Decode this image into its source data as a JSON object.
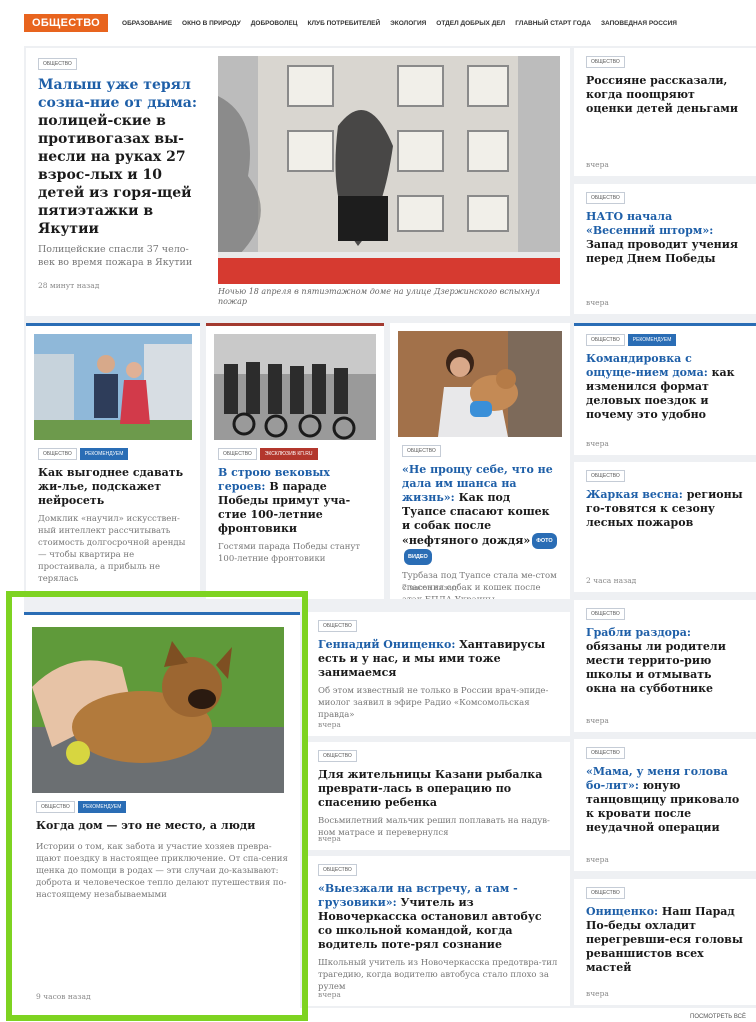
{
  "header": {
    "section": "ОБЩЕСТВО",
    "nav": [
      "ОБРАЗОВАНИЕ",
      "ОКНО В ПРИРОДУ",
      "ДОБРОВОЛЕЦ",
      "КЛУБ ПОТРЕБИТЕЛЕЙ",
      "ЭКОЛОГИЯ",
      "ОТДЕЛ ДОБРЫХ ДЕЛ",
      "ГЛАВНЫЙ СТАРТ ГОДА",
      "ЗАПОВЕДНАЯ РОССИЯ"
    ]
  },
  "main": {
    "tag": "ОБЩЕСТВО",
    "lead": "Малыш уже терял созна-ние от дыма:",
    "title": " полицей-ские в противогазах вы-несли на руках 27 взрос-лых и 10 детей из горя-щей пятиэтажки в Якутии",
    "desc": "Полицейские спасли 37 чело-век во время пожара в Якутии",
    "time": "28 минут назад",
    "caption": "Ночью 18 апреля в пятиэтажном доме на улице Дзержинского вспыхнул пожар"
  },
  "right_cards": [
    {
      "tags": [
        "ОБЩЕСТВО"
      ],
      "lead": "",
      "title": "Россияне рассказали, когда поощряют оценки детей деньгами",
      "time": "вчера"
    },
    {
      "tags": [
        "ОБЩЕСТВО"
      ],
      "lead": "НАТО начала «Весенний шторм»:",
      "title": " Запад проводит учения перед Днем Победы",
      "time": "вчера"
    },
    {
      "tags": [
        "ОБЩЕСТВО",
        "РЕКОМЕНДУЕМ"
      ],
      "lead": "Командировка с ощуще-нием дома:",
      "title": " как изменился формат деловых поездок и почему это удобно",
      "time": "вчера"
    },
    {
      "tags": [
        "ОБЩЕСТВО"
      ],
      "lead": "Жаркая весна:",
      "title": " регионы го-товятся к сезону лесных пожаров",
      "time": "2 часа назад"
    },
    {
      "tags": [
        "ОБЩЕСТВО"
      ],
      "lead": "Грабли раздора:",
      "title": " обязаны ли родители мести террито-рию школы и отмывать окна на субботнике",
      "time": "вчера"
    },
    {
      "tags": [
        "ОБЩЕСТВО"
      ],
      "lead": "«Мама, у меня голова бо-лит»:",
      "title": " юную танцовщицу приковало к кровати после неудачной операции",
      "time": "вчера"
    },
    {
      "tags": [
        "ОБЩЕСТВО"
      ],
      "lead": "Онищенко:",
      "title": " Наш Парад По-беды охладит перегревши-еся головы реваншистов всех мастей",
      "time": "вчера"
    }
  ],
  "row2": [
    {
      "tags": [
        "ОБЩЕСТВО",
        "РЕКОМЕНДУЕМ"
      ],
      "lead": "",
      "title": "Как выгоднее сдавать жи-лье, подскажет нейросеть",
      "desc": "Домклик «научил» искусствен-ный интеллект рассчитывать стоимость долгосрочной аренды — чтобы квартира не простаивала, а прибыль не терялась",
      "time": "вчера вчера"
    },
    {
      "tags": [
        "ОБЩЕСТВО",
        "ЭКСКЛЮЗИВ КП.RU"
      ],
      "lead": "В строю вековых героев:",
      "title": " В параде Победы примут уча-стие 100-летние фронтовики",
      "desc": "Гостями парада Победы станут 100-летние фронтовики",
      "time": "5 часов назад"
    },
    {
      "tags": [
        "ОБЩЕСТВО"
      ],
      "lead": "«Не прощу себе, что не дала им шанса на жизнь»:",
      "title": " Как под Туапсе спасают кошек и собак после «нефтяного дождя»",
      "pills": [
        "ФОТО",
        "ВИДЕО"
      ],
      "desc": "Турбаза под Туапсе стала ме-стом спасения собак и кошек после атак БПЛА Украины",
      "time": "7 часов назад"
    }
  ],
  "featured": {
    "tags": [
      "ОБЩЕСТВО",
      "РЕКОМЕНДУЕМ"
    ],
    "title": "Когда дом — это не место, а люди",
    "desc": "Истории о том, как забота и участие хозяев превра-щают поездку в настоящее приключение. От спа-сения щенка до помощи в родах — эти случаи до-казывают: доброта и человеческое тепло делают путешествия по-настоящему незабываемыми",
    "time": "9 часов назад"
  },
  "list": [
    {
      "tags": [
        "ОБЩЕСТВО"
      ],
      "lead": "Геннадий Онищенко:",
      "title": " Хантавирусы есть и у нас, и мы ими тоже занимаемся",
      "desc": "Об этом известный не только в России врач-эпиде-миолог заявил в эфире Радио «Комсомольская правда»",
      "time": "вчера"
    },
    {
      "tags": [
        "ОБЩЕСТВО"
      ],
      "lead": "",
      "title": "Для жительницы Казани рыбалка преврати-лась в операцию по спасению ребенка",
      "desc": "Восьмилетний мальчик решил поплавать на надув-ном матрасе и перевернулся",
      "time": "вчера"
    },
    {
      "tags": [
        "ОБЩЕСТВО"
      ],
      "lead": "«Выезжали на встречу, а там - грузовики»:",
      "title": " Учитель из Новочеркасска остановил автобус со школьной командой, когда водитель поте-рял сознание",
      "desc": "Школьный учитель из Новочеркасска предотвра-тил трагедию, когда водителю автобуса стало плохо за рулем",
      "time": "вчера"
    }
  ],
  "footer": {
    "more": "ПОСМОТРЕТЬ ВСЁ"
  },
  "colors": {
    "accent": "#e8641e",
    "link": "#1e5fa8",
    "highlight": "#7ed321"
  }
}
